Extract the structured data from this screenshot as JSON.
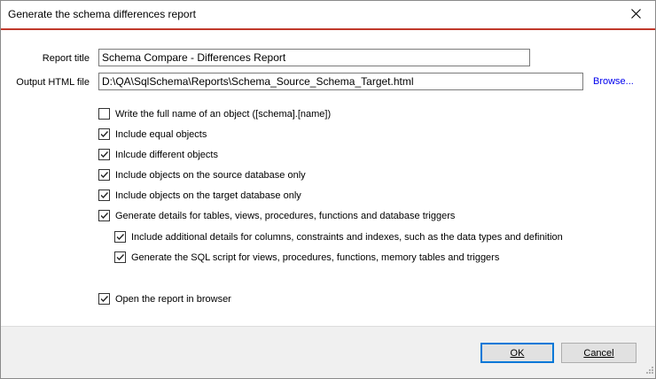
{
  "window": {
    "title": "Generate the schema differences report"
  },
  "form": {
    "report_title_label": "Report title",
    "report_title_value": "Schema Compare - Differences Report",
    "output_label": "Output HTML file",
    "output_value": "D:\\QA\\SqlSchema\\Reports\\Schema_Source_Schema_Target.html",
    "browse_label": "Browse..."
  },
  "options": [
    {
      "label": "Write the full name of an object ([schema].[name])",
      "checked": false
    },
    {
      "label": "Include equal objects",
      "checked": true
    },
    {
      "label": "Inlcude different objects",
      "checked": true
    },
    {
      "label": "Include objects on the source database only",
      "checked": true
    },
    {
      "label": "Include objects on the target database only",
      "checked": true
    },
    {
      "label": "Generate details for tables, views, procedures, functions and database triggers",
      "checked": true
    },
    {
      "label": "Include additional details for columns, constraints and indexes, such as the data types and definition",
      "checked": true
    },
    {
      "label": "Generate the SQL script for views, procedures, functions, memory tables and triggers",
      "checked": true
    },
    {
      "label": "Open the report in browser",
      "checked": true
    }
  ],
  "buttons": {
    "ok_label": "OK",
    "cancel_label": "Cancel"
  }
}
